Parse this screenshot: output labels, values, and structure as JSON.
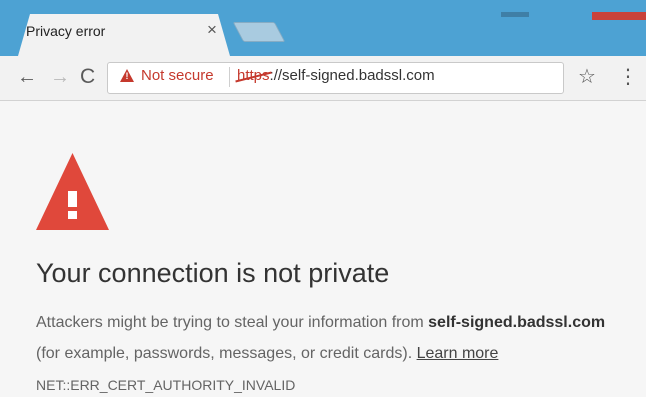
{
  "browser": {
    "tab_title": "Privacy error",
    "tab_close": "×",
    "nav": {
      "back": "←",
      "forward": "→",
      "reload": "C"
    },
    "security_label": "Not secure",
    "url_scheme": "https",
    "url_rest": "://self-signed.badssl.com",
    "star": "☆",
    "menu": "⋮"
  },
  "colors": {
    "tabstrip": "#4da2d3",
    "warning_red": "#c5392d",
    "big_warning_red": "#e0483b"
  },
  "page": {
    "heading": "Your connection is not private",
    "line1_prefix": "Attackers might be trying to steal your information from ",
    "line1_domain": "self-signed.badssl.com",
    "line2_prefix": "(for example, passwords, messages, or credit cards). ",
    "learn_more": "Learn more",
    "error_code": "NET::ERR_CERT_AUTHORITY_INVALID"
  },
  "icons": {
    "big_warning": "warning-triangle-icon",
    "small_warning": "warning-triangle-icon"
  }
}
